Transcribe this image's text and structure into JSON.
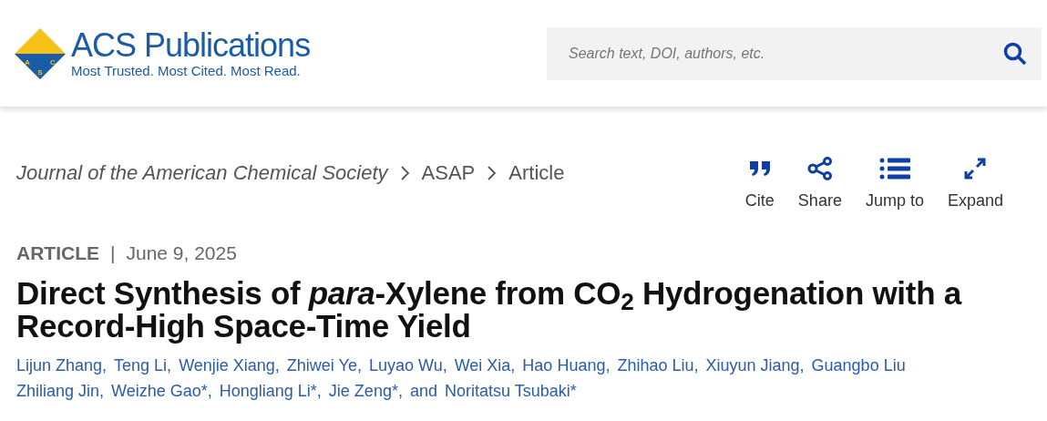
{
  "logo": {
    "name": "ACS Publications",
    "tagline": "Most Trusted. Most Cited. Most Read.",
    "letters": [
      "A",
      "C",
      "S"
    ]
  },
  "search": {
    "placeholder": "Search text, DOI, authors, etc."
  },
  "breadcrumbs": [
    "Journal of the American Chemical Society",
    "ASAP",
    "Article"
  ],
  "tools": [
    {
      "kind": "cite",
      "label": "Cite"
    },
    {
      "kind": "share",
      "label": "Share"
    },
    {
      "kind": "jump",
      "label": "Jump to"
    },
    {
      "kind": "expand",
      "label": "Expand"
    }
  ],
  "article": {
    "type": "ARTICLE",
    "separator": "|",
    "date": "June 9, 2025",
    "title": "Direct Synthesis of *para*-Xylene from CO$_{2}$ Hydrogenation with a Record-High Space-Time Yield"
  },
  "authors": [
    {
      "name": "Lijun Zhang,"
    },
    {
      "name": "Teng Li,"
    },
    {
      "name": "Wenjie Xiang,"
    },
    {
      "name": "Zhiwei Ye,"
    },
    {
      "name": "Luyao Wu,"
    },
    {
      "name": "Wei Xia,"
    },
    {
      "name": "Hao Huang,"
    },
    {
      "name": "Zhihao Liu,"
    },
    {
      "name": "Xiuyun Jiang,"
    },
    {
      "name": "Guangbo Liu"
    },
    {
      "name": "Zhiliang Jin,"
    },
    {
      "name": "Weizhe Gao*,"
    },
    {
      "name": "Hongliang Li*,"
    },
    {
      "name": "Jie Zeng*,"
    },
    {
      "name": "Noritatsu Tsubaki*"
    }
  ],
  "author_conjunction": "and"
}
